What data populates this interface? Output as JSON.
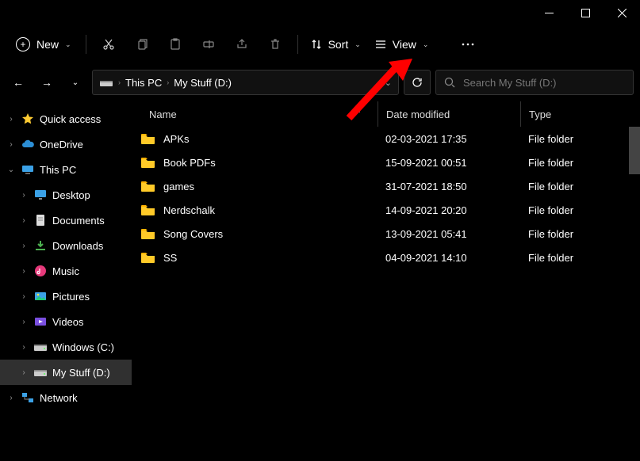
{
  "window": {
    "minimize": "—",
    "maximize": "▢",
    "close": "✕"
  },
  "toolbar": {
    "new_label": "New",
    "sort_label": "Sort",
    "view_label": "View"
  },
  "breadcrumb": {
    "root": "This PC",
    "current": "My Stuff (D:)"
  },
  "search": {
    "placeholder": "Search My Stuff (D:)"
  },
  "sidebar": {
    "items": [
      {
        "chev": "›",
        "icon": "star",
        "label": "Quick access",
        "cls": "root"
      },
      {
        "chev": "›",
        "icon": "cloud",
        "label": "OneDrive",
        "cls": "root"
      },
      {
        "chev": "⌄",
        "icon": "pc",
        "label": "This PC",
        "cls": "root"
      },
      {
        "chev": "›",
        "icon": "desktop",
        "label": "Desktop",
        "cls": "child"
      },
      {
        "chev": "›",
        "icon": "doc",
        "label": "Documents",
        "cls": "child"
      },
      {
        "chev": "›",
        "icon": "download",
        "label": "Downloads",
        "cls": "child"
      },
      {
        "chev": "›",
        "icon": "music",
        "label": "Music",
        "cls": "child"
      },
      {
        "chev": "›",
        "icon": "pic",
        "label": "Pictures",
        "cls": "child"
      },
      {
        "chev": "›",
        "icon": "video",
        "label": "Videos",
        "cls": "child"
      },
      {
        "chev": "›",
        "icon": "drive",
        "label": "Windows (C:)",
        "cls": "child"
      },
      {
        "chev": "›",
        "icon": "drive",
        "label": "My Stuff (D:)",
        "cls": "child active"
      },
      {
        "chev": "›",
        "icon": "network",
        "label": "Network",
        "cls": "root"
      }
    ]
  },
  "columns": {
    "name": "Name",
    "date": "Date modified",
    "type": "Type"
  },
  "files": [
    {
      "name": "APKs",
      "date": "02-03-2021 17:35",
      "type": "File folder"
    },
    {
      "name": "Book PDFs",
      "date": "15-09-2021 00:51",
      "type": "File folder"
    },
    {
      "name": "games",
      "date": "31-07-2021 18:50",
      "type": "File folder"
    },
    {
      "name": "Nerdschalk",
      "date": "14-09-2021 20:20",
      "type": "File folder"
    },
    {
      "name": "Song Covers",
      "date": "13-09-2021 05:41",
      "type": "File folder"
    },
    {
      "name": "SS",
      "date": "04-09-2021 14:10",
      "type": "File folder"
    }
  ]
}
